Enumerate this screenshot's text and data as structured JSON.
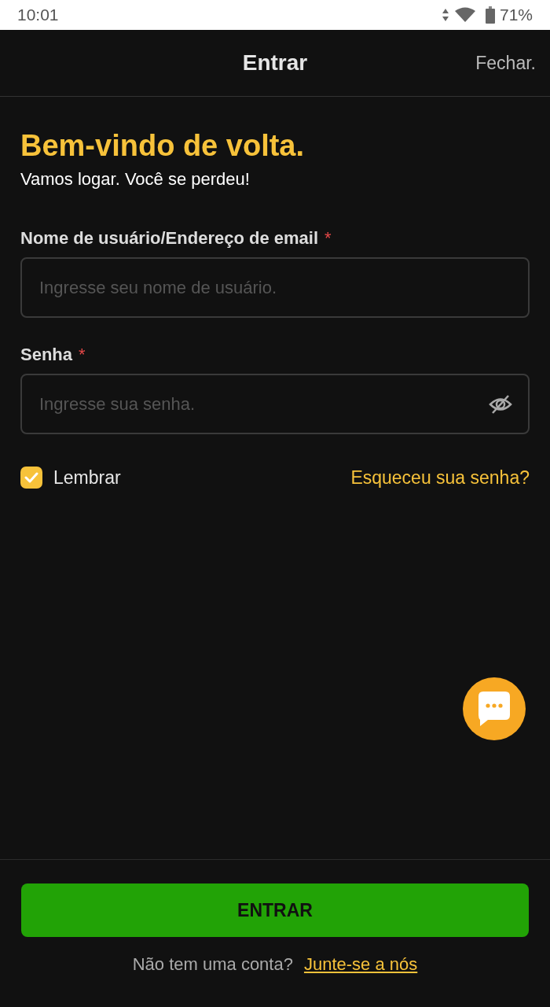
{
  "status_bar": {
    "time": "10:01",
    "battery": "71%"
  },
  "header": {
    "title": "Entrar",
    "close": "Fechar."
  },
  "welcome": {
    "title": "Bem-vindo de volta.",
    "subtitle": "Vamos logar. Você se perdeu!"
  },
  "fields": [
    {
      "kind": "text",
      "label": "Nome de usuário/Endereço de email",
      "required_mark": "*",
      "placeholder": "Ingresse seu nome de usuário."
    },
    {
      "kind": "password",
      "label": "Senha",
      "required_mark": "*",
      "placeholder": "Ingresse sua senha."
    }
  ],
  "remember": {
    "label": "Lembrar",
    "checked": true
  },
  "forgot_link": "Esqueceu sua senha?",
  "submit_button": "ENTRAR",
  "signup": {
    "prompt": "Não tem uma conta?",
    "link": "Junte-se a nós"
  }
}
